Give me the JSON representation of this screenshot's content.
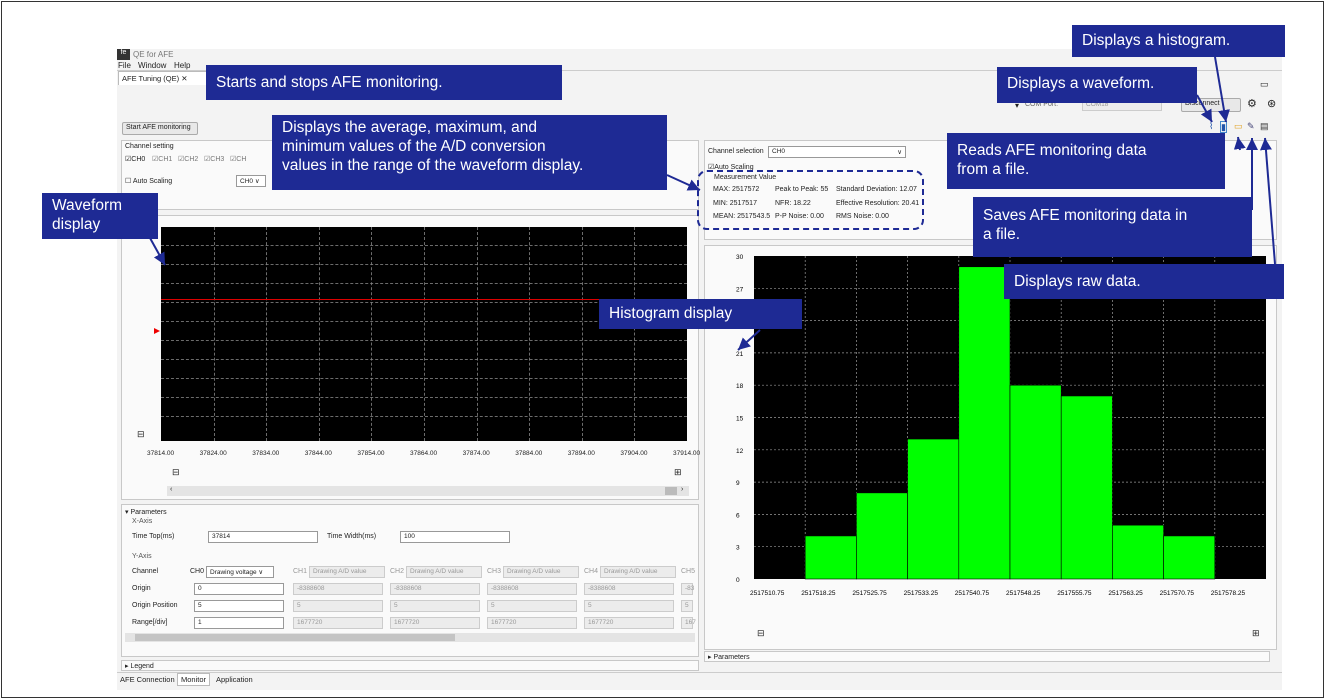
{
  "app": {
    "title": "QE for AFE",
    "menu": [
      "File",
      "Window",
      "Help"
    ],
    "tab": "AFE Tuning (QE)",
    "bottom_tabs": [
      "AFE Connection",
      "Monitor",
      "Application"
    ]
  },
  "toolbar": {
    "com_port_label": "COM Port:",
    "com_port_value": "COM18",
    "disconnect": "Disconnect"
  },
  "left": {
    "start_button": "Start AFE monitoring",
    "channel_setting": "Channel setting",
    "channels": [
      "CH0",
      "CH1",
      "CH2",
      "CH3",
      "CH"
    ],
    "auto_scaling": "Auto Scaling",
    "ch_select": "CH0",
    "x_ticks": [
      "37814.00",
      "37824.00",
      "37834.00",
      "37844.00",
      "37854.00",
      "37864.00",
      "37874.00",
      "37884.00",
      "37894.00",
      "37904.00",
      "37914.00"
    ],
    "parameters": "Parameters",
    "x_axis": "X-Axis",
    "time_top_label": "Time Top(ms)",
    "time_top": "37814",
    "time_width_label": "Time Width(ms)",
    "time_width": "100",
    "y_axis": "Y-Axis",
    "channel_label": "Channel",
    "origin_label": "Origin",
    "origin_pos_label": "Origin Position",
    "range_label": "Range[/div]",
    "ch0": {
      "name": "CH0",
      "mode": "Drawing voltage",
      "origin": "0",
      "pos": "5",
      "range": "1"
    },
    "others": [
      {
        "name": "CH1",
        "mode": "Drawing A/D value",
        "origin": "-8388608",
        "pos": "5",
        "range": "1677720"
      },
      {
        "name": "CH2",
        "mode": "Drawing A/D value",
        "origin": "-8388608",
        "pos": "5",
        "range": "1677720"
      },
      {
        "name": "CH3",
        "mode": "Drawing A/D value",
        "origin": "-8388608",
        "pos": "5",
        "range": "1677720"
      },
      {
        "name": "CH4",
        "mode": "Drawing A/D value",
        "origin": "-8388608",
        "pos": "5",
        "range": "1677720"
      },
      {
        "name": "CH5",
        "mode": "",
        "origin": "-83",
        "pos": "5",
        "range": "167"
      }
    ],
    "legend": "Legend"
  },
  "right": {
    "channel_selection": "Channel selection",
    "channel_value": "CH0",
    "auto_scaling": "Auto Scaling",
    "measurement_value": "Measurement Value",
    "m": [
      [
        "MAX: 2517572",
        "Peak to Peak: 55",
        "Standard Deviation: 12.07"
      ],
      [
        "MIN: 2517517",
        "NFR: 18.22",
        "Effective Resolution: 20.41"
      ],
      [
        "MEAN: 2517543.5",
        "P-P Noise: 0.00",
        "RMS Noise: 0.00"
      ]
    ],
    "parameters": "Parameters"
  },
  "chart_data": {
    "type": "bar",
    "categories": [
      "2517510.75",
      "2517518.25",
      "2517525.75",
      "2517533.25",
      "2517540.75",
      "2517548.25",
      "2517555.75",
      "2517563.25",
      "2517570.75",
      "2517578.25"
    ],
    "values": [
      0,
      4,
      8,
      13,
      29,
      18,
      17,
      5,
      4,
      0
    ],
    "y_ticks": [
      "30",
      "27",
      "24",
      "21",
      "18",
      "15",
      "12",
      "9",
      "6",
      "3",
      "0"
    ],
    "ylim": [
      0,
      30
    ],
    "bar_color": "#00ff00"
  },
  "callouts": {
    "start": "Starts and stops AFE monitoring.",
    "measure": [
      "Displays the average, maximum, and",
      "minimum values of the A/D conversion",
      "values in the range of the waveform display."
    ],
    "waveform": [
      "Waveform",
      "display"
    ],
    "histogram_display": "Histogram display",
    "histogram": "Displays a histogram.",
    "wave_btn": "Displays a waveform.",
    "read": [
      "Reads AFE monitoring data",
      "from a file."
    ],
    "save": [
      "Saves AFE monitoring data in",
      "a file."
    ],
    "raw": "Displays raw data."
  }
}
